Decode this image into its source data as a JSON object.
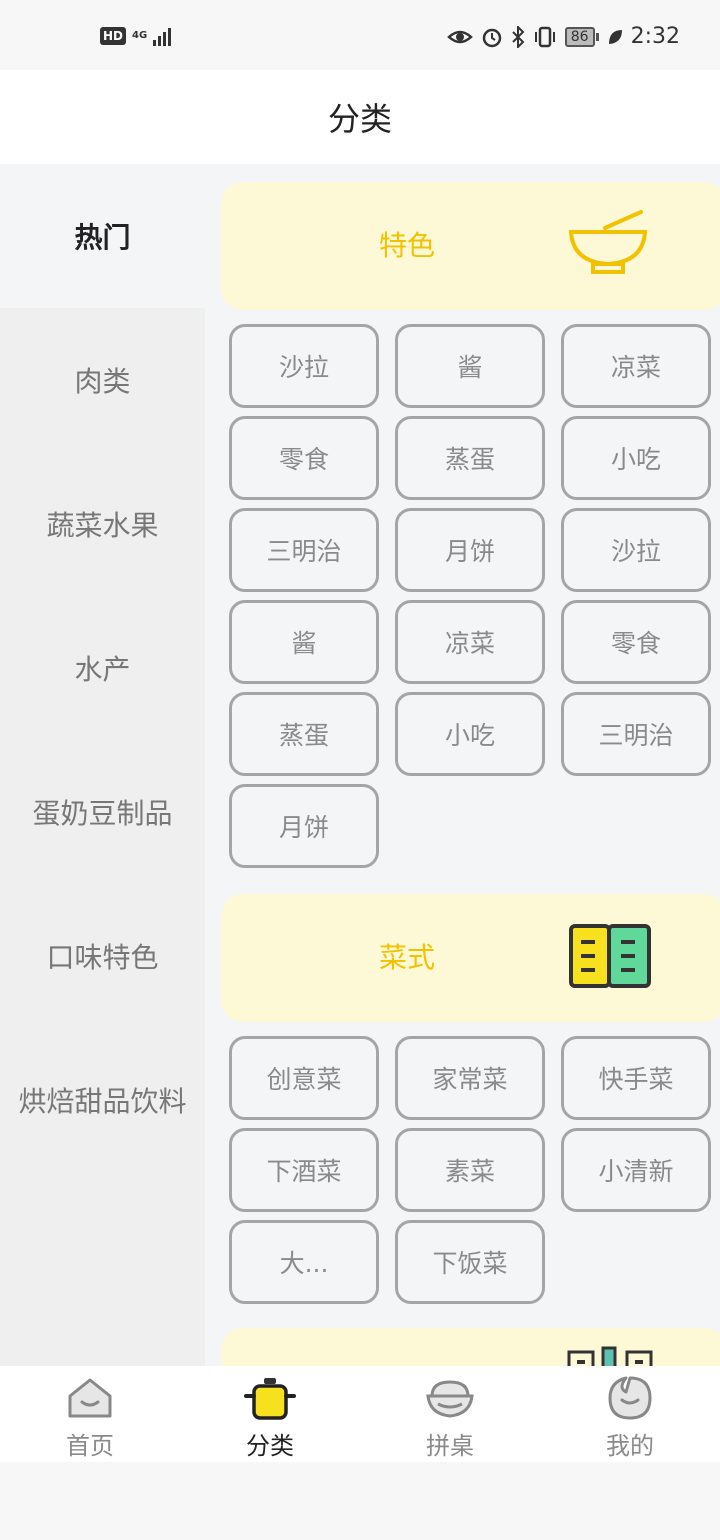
{
  "status_bar": {
    "hd": "HD",
    "network": "4G",
    "battery": "86",
    "time": "2:32"
  },
  "header": {
    "title": "分类"
  },
  "sidebar": {
    "items": [
      {
        "label": "热门",
        "active": true
      },
      {
        "label": "肉类"
      },
      {
        "label": "蔬菜水果"
      },
      {
        "label": "水产"
      },
      {
        "label": "蛋奶豆制品"
      },
      {
        "label": "口味特色"
      },
      {
        "label": "烘焙甜品饮料"
      }
    ]
  },
  "sections": [
    {
      "title": "特色",
      "icon": "bowl-icon",
      "chips": [
        "沙拉",
        "酱",
        "凉菜",
        "零食",
        "蒸蛋",
        "小吃",
        "三明治",
        "月饼",
        "沙拉",
        "酱",
        "凉菜",
        "零食",
        "蒸蛋",
        "小吃",
        "三明治",
        "月饼"
      ]
    },
    {
      "title": "菜式",
      "icon": "recipe-book-icon",
      "chips": [
        "创意菜",
        "家常菜",
        "快手菜",
        "下酒菜",
        "素菜",
        "小清新",
        "大...",
        "下饭菜"
      ]
    }
  ],
  "bottom_nav": [
    {
      "label": "首页",
      "icon": "home-icon"
    },
    {
      "label": "分类",
      "icon": "pot-icon",
      "active": true
    },
    {
      "label": "拼桌",
      "icon": "bowl-icon"
    },
    {
      "label": "我的",
      "icon": "profile-icon"
    }
  ],
  "colors": {
    "accent_yellow": "#f2c200",
    "banner_bg": "#fdf8d6",
    "icon_green": "#5fd89a"
  }
}
